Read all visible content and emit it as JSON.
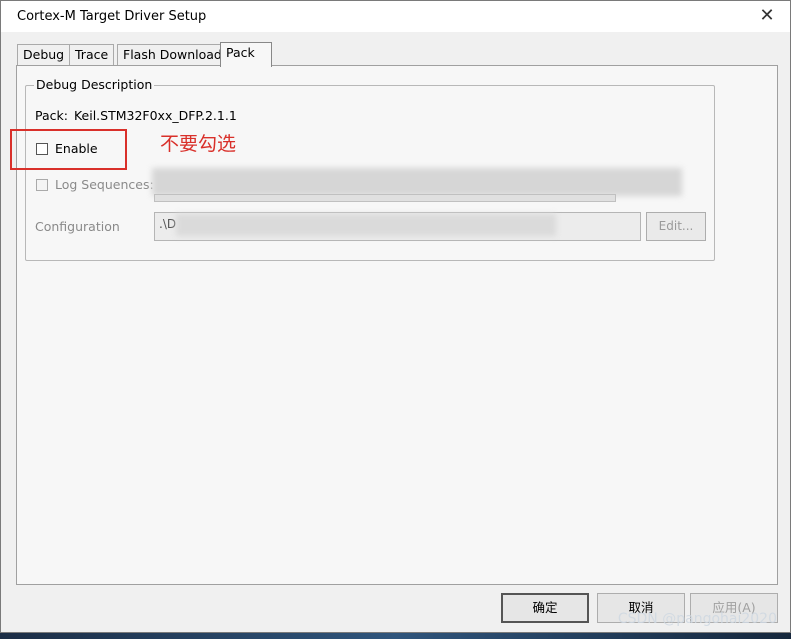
{
  "window": {
    "title": "Cortex-M Target Driver Setup"
  },
  "tabs": [
    {
      "label": "Debug"
    },
    {
      "label": "Trace"
    },
    {
      "label": "Flash Download"
    },
    {
      "label": "Pack"
    }
  ],
  "group": {
    "legend": "Debug Description",
    "pack_label": "Pack:",
    "pack_value": "Keil.STM32F0xx_DFP.2.1.1",
    "enable_label": "Enable",
    "log_label": "Log Sequences:",
    "config_label": "Configuration",
    "config_value": ".\\D",
    "edit_label": "Edit..."
  },
  "annotation": {
    "text": "不要勾选",
    "color": "#d9302a"
  },
  "buttons": {
    "ok": "确定",
    "cancel": "取消",
    "apply": "应用(A)"
  },
  "watermark": "CSDN @pangohai2020"
}
